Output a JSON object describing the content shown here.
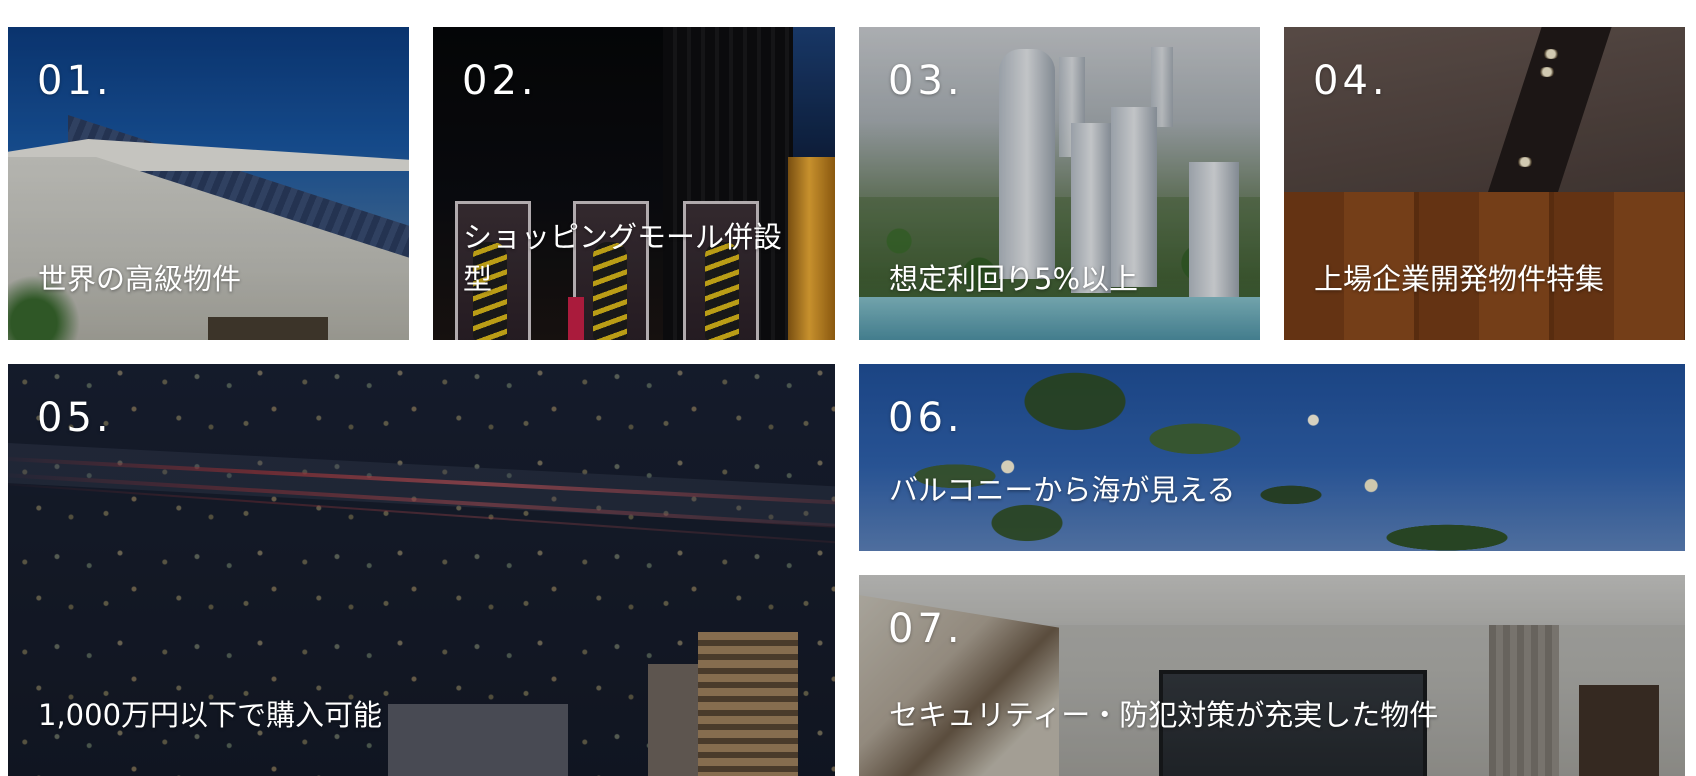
{
  "tiles": [
    {
      "number": "01.",
      "label": "世界の高級物件"
    },
    {
      "number": "02.",
      "label": "ショッピングモール併設型"
    },
    {
      "number": "03.",
      "label": "想定利回り5%以上"
    },
    {
      "number": "04.",
      "label": "上場企業開発物件特集"
    },
    {
      "number": "05.",
      "label": "1,000万円以下で購入可能"
    },
    {
      "number": "06.",
      "label": "バルコニーから海が見える"
    },
    {
      "number": "07.",
      "label": "セキュリティー・防犯対策が充実した物件"
    }
  ]
}
